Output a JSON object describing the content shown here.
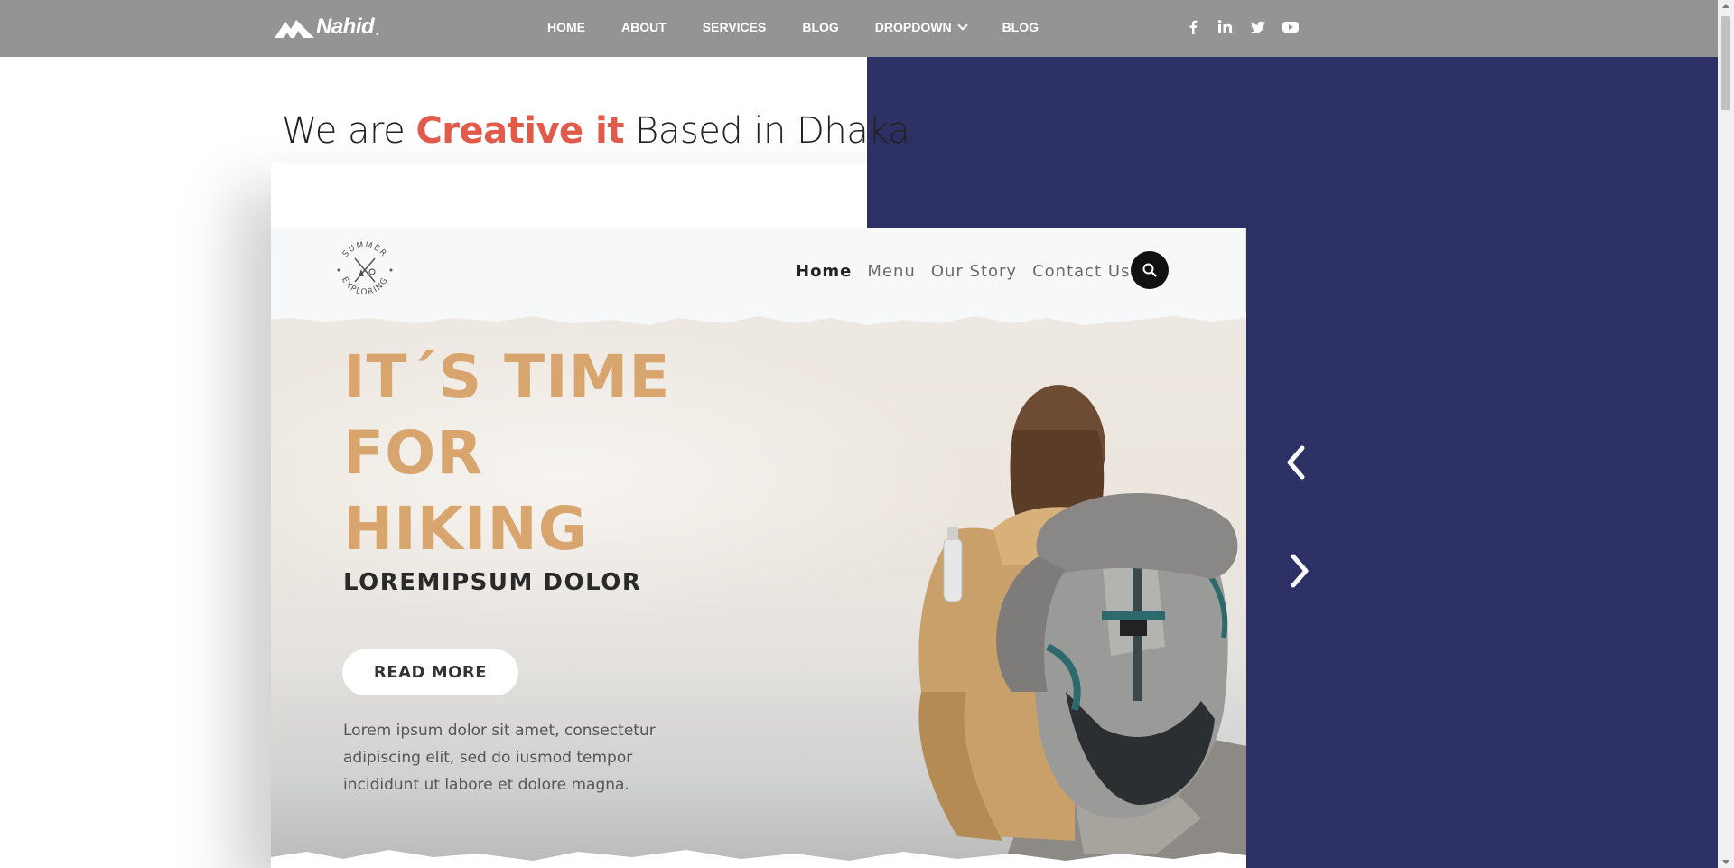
{
  "brand": {
    "name": "Nahid",
    "suffix": "."
  },
  "nav": {
    "items": [
      {
        "label": "HOME"
      },
      {
        "label": "ABOUT"
      },
      {
        "label": "SERVICES"
      },
      {
        "label": "BLOG"
      },
      {
        "label": "DROPDOWN",
        "has_dropdown": true
      },
      {
        "label": "BLOG"
      }
    ]
  },
  "social": [
    "facebook-icon",
    "linkedin-icon",
    "twitter-icon",
    "youtube-icon"
  ],
  "headline": {
    "before": "We are ",
    "accent": "Creative it",
    "after": " Based in Dhaka"
  },
  "slide": {
    "badge": {
      "top_text": "SUMMER",
      "bottom_text": "EXPLORING"
    },
    "nav": [
      "Home",
      "Menu",
      "Our Story",
      "Contact Us"
    ],
    "hero_title": [
      "IT´S TIME",
      "FOR",
      "HIKING"
    ],
    "hero_subtitle": "LOREMIPSUM DOLOR",
    "cta": "READ MORE",
    "body": "Lorem ipsum dolor sit amet, consectetur adipiscing elit, sed do iusmod tempor incididunt ut labore et dolore magna."
  },
  "colors": {
    "topbar": "#949494",
    "navy": "#2e3166",
    "accent": "#e25a4a",
    "hero_title": "#d9a56e"
  }
}
